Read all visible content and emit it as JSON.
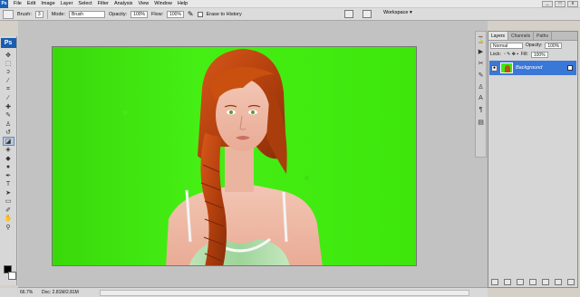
{
  "menubar": {
    "logo": "Ps",
    "items": [
      "File",
      "Edit",
      "Image",
      "Layer",
      "Select",
      "Filter",
      "Analysis",
      "View",
      "Window",
      "Help"
    ]
  },
  "options": {
    "brush_label": "Brush:",
    "brush_size": "3",
    "mode_label": "Mode:",
    "mode_value": "Brush",
    "opacity_label": "Opacity:",
    "opacity_value": "100%",
    "flow_label": "Flow:",
    "flow_value": "100%",
    "erase_history": "Erase to History",
    "workspace": "Workspace"
  },
  "toolbox": {
    "logo": "Ps",
    "tools": [
      "move-icon",
      "marquee-icon",
      "lasso-icon",
      "magic-wand-icon",
      "crop-icon",
      "eyedropper-icon",
      "healing-icon",
      "brush-icon",
      "clone-stamp-icon",
      "history-brush-icon",
      "eraser-icon",
      "paint-bucket-icon",
      "blur-icon",
      "dodge-icon",
      "pen-icon",
      "type-icon",
      "path-select-icon",
      "shape-icon",
      "notes-icon",
      "hand-icon",
      "zoom-icon"
    ]
  },
  "panel": {
    "tabs": [
      "Layers",
      "Channels",
      "Paths"
    ],
    "blend_mode": "Normal",
    "opacity_label": "Opacity:",
    "opacity_value": "100%",
    "lock_label": "Lock:",
    "fill_label": "Fill:",
    "fill_value": "100%",
    "layer_name": "Background"
  },
  "status": {
    "zoom": "66.7%",
    "doc_size": "Doc: 2.81M/2.81M"
  },
  "colors": {
    "canvas_green": "#3ee80b",
    "selection_blue": "#3a78d8",
    "hair": "#c24c12"
  }
}
